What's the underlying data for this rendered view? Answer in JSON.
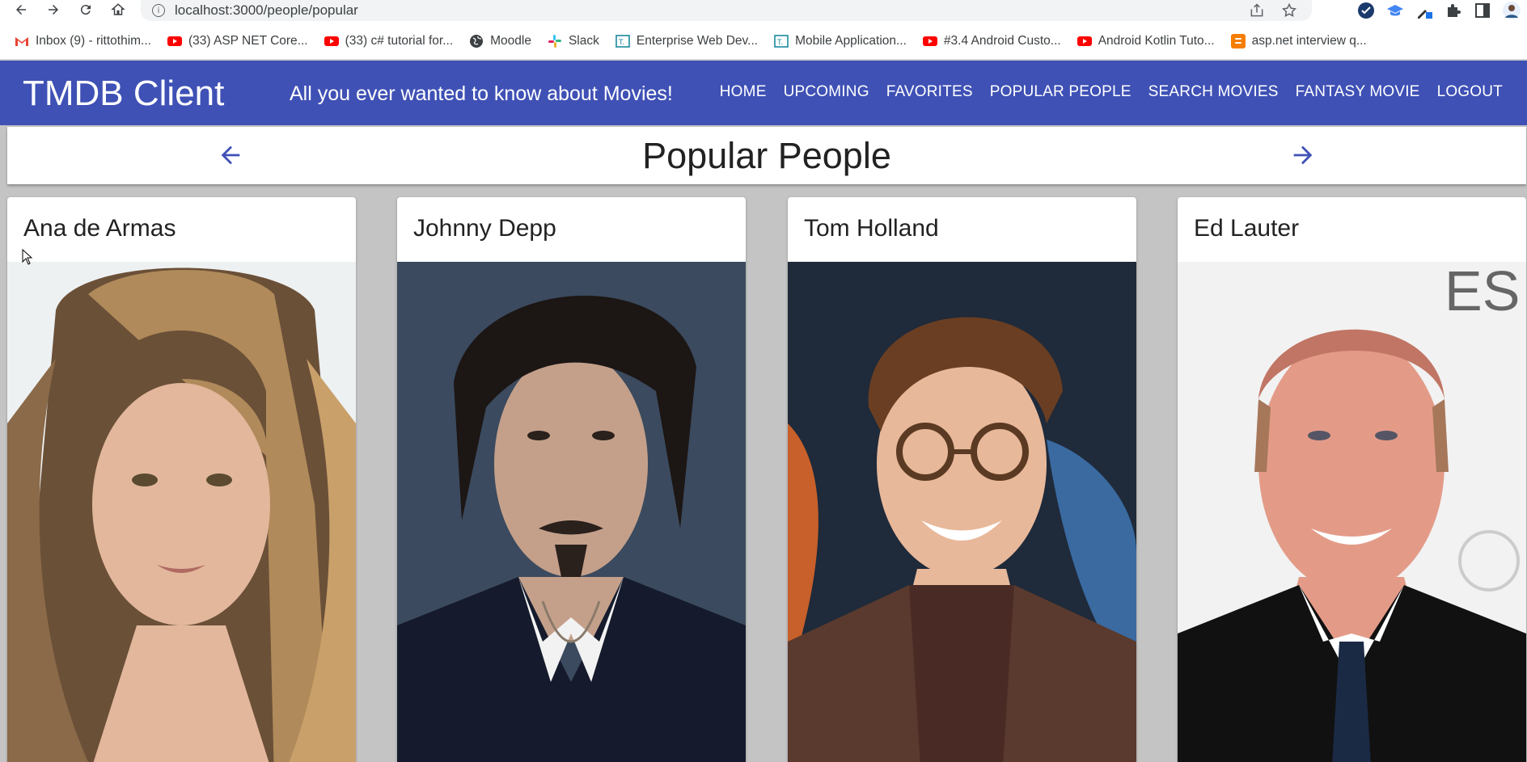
{
  "browser": {
    "url": "localhost:3000/people/popular",
    "bookmarks": [
      {
        "label": "Inbox (9) - rittothim...",
        "icon": "gmail-icon"
      },
      {
        "label": "(33) ASP NET Core...",
        "icon": "youtube-icon"
      },
      {
        "label": "(33) c# tutorial for...",
        "icon": "youtube-icon"
      },
      {
        "label": "Moodle",
        "icon": "globe-icon"
      },
      {
        "label": "Slack",
        "icon": "slack-icon"
      },
      {
        "label": "Enterprise Web Dev...",
        "icon": "teams-icon"
      },
      {
        "label": "Mobile Application...",
        "icon": "teams-icon"
      },
      {
        "label": "#3.4 Android Custo...",
        "icon": "youtube-icon"
      },
      {
        "label": "Android Kotlin Tuto...",
        "icon": "youtube-icon"
      },
      {
        "label": "asp.net interview q...",
        "icon": "blogger-icon"
      }
    ]
  },
  "app": {
    "title": "TMDB Client",
    "tagline": "All you ever wanted to know about Movies!",
    "nav": [
      "Home",
      "Upcoming",
      "Favorites",
      "Popular People",
      "Search Movies",
      "Fantasy Movie",
      "Logout"
    ],
    "accent": "#3f51b5"
  },
  "page": {
    "title": "Popular People"
  },
  "people": [
    {
      "name": "Ana de Armas"
    },
    {
      "name": "Johnny Depp"
    },
    {
      "name": "Tom Holland"
    },
    {
      "name": "Ed Lauter"
    }
  ]
}
